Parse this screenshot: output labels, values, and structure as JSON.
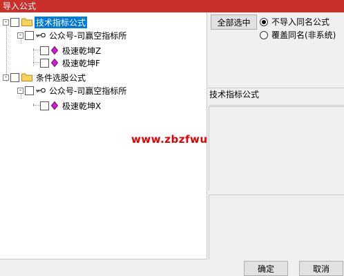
{
  "window": {
    "title": "导入公式"
  },
  "tree": {
    "groups": [
      {
        "label": "技术指标公式",
        "expander": "-",
        "children": [
          {
            "label": "公众号-司赢空指标所",
            "expander": "-",
            "children": [
              {
                "label": "极速乾坤Z"
              },
              {
                "label": "极速乾坤F"
              }
            ]
          }
        ]
      },
      {
        "label": "条件选股公式",
        "expander": "-",
        "children": [
          {
            "label": "公众号-司赢空指标所",
            "expander": "-",
            "children": [
              {
                "label": "极速乾坤X"
              }
            ]
          }
        ]
      }
    ]
  },
  "watermark": "www.zbzfwu.com",
  "controls": {
    "select_all_label": "全部选中",
    "radio_options": [
      {
        "label": "不导入同名公式",
        "checked": true
      },
      {
        "label": "覆盖同名(非系统)",
        "checked": false
      }
    ],
    "type_label": "技术指标公式"
  },
  "footer": {
    "ok_label": "确定",
    "cancel_label": "取消"
  },
  "colors": {
    "titlebar": "#c9302c",
    "selection": "#0078d7",
    "watermark": "#e60000"
  }
}
